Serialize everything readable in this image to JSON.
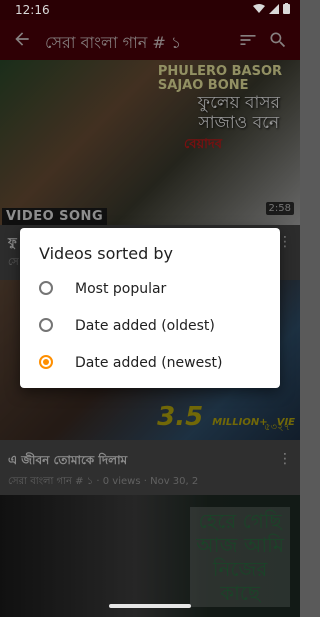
{
  "status_bar": {
    "time": "12:16"
  },
  "app_bar": {
    "title": "সেরা বাংলা গান # ১"
  },
  "videos": [
    {
      "thumbnail_text_en": "PHULERO BASOR\nSAJAO BONE",
      "thumbnail_text_bn": "ফুলেয় বাসর\nসাজাও বনে",
      "thumbnail_text_red": "বেয়াদব",
      "badge": "VIDEO SONG",
      "duration": "2:58",
      "title": "ফু",
      "meta": "সে"
    },
    {
      "overlay_big": "3.5",
      "overlay_unit": "MILLION+",
      "overlay_views": "VIE",
      "overlay_small": "৫৩২৭",
      "title": "এ জীবন তোমাকে দিলাম",
      "channel": "সেরা বাংলা গান # ১",
      "views": "0 views",
      "date": "Nov 30, 2"
    },
    {
      "thumbnail_text": "হেরে গেছি\nআজ আমি\nনিজের\nকাছে"
    }
  ],
  "dialog": {
    "title": "Videos sorted by",
    "options": [
      {
        "label": "Most popular",
        "selected": false
      },
      {
        "label": "Date added (oldest)",
        "selected": false
      },
      {
        "label": "Date added (newest)",
        "selected": true
      }
    ]
  },
  "colors": {
    "app_bar": "#4c0009",
    "accent": "#ff8f00",
    "dialog_bg": "#ffffff"
  },
  "icons": [
    "back-arrow-icon",
    "sort-icon",
    "search-icon",
    "wifi-icon",
    "signal-icon",
    "battery-icon",
    "more-vert-icon"
  ]
}
